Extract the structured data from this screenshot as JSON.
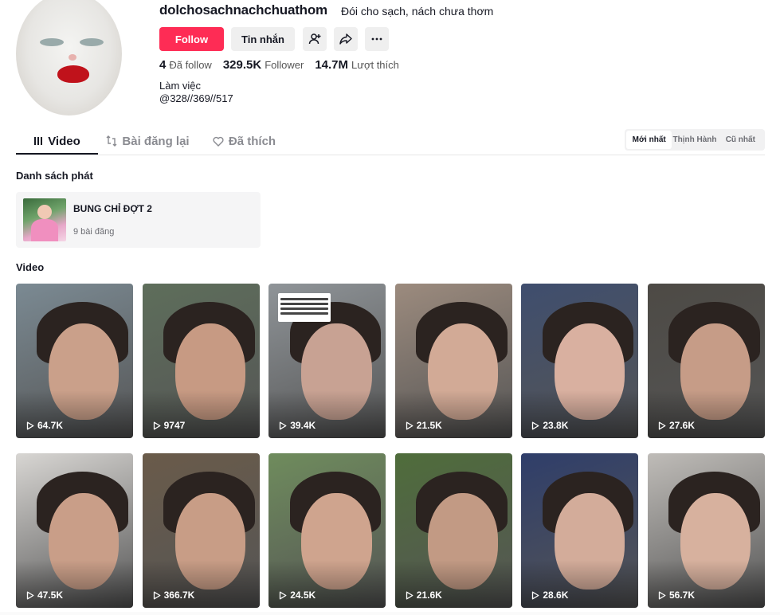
{
  "profile": {
    "username": "dolchosachnachchuathom",
    "nickname": "Đói cho sạch, nách chưa thơm",
    "follow_label": "Follow",
    "message_label": "Tin nhắn",
    "stats": [
      {
        "value": "4",
        "label": "Đã follow"
      },
      {
        "value": "329.5K",
        "label": "Follower"
      },
      {
        "value": "14.7M",
        "label": "Lượt thích"
      }
    ],
    "bio_line1": "Làm việc",
    "bio_line2": "@328//369//517"
  },
  "tabs": [
    {
      "label": "Video",
      "icon": "grid-lines-icon",
      "active": true
    },
    {
      "label": "Bài đăng lại",
      "icon": "repost-icon",
      "active": false
    },
    {
      "label": "Đã thích",
      "icon": "heart-outline-icon",
      "active": false
    }
  ],
  "sort": [
    {
      "label": "Mới nhất",
      "active": true
    },
    {
      "label": "Thịnh Hành",
      "active": false
    },
    {
      "label": "Cũ nhất",
      "active": false
    }
  ],
  "playlist_section": {
    "title": "Danh sách phát",
    "name": "BUNG CHỈ ĐỢT 2",
    "count": "9 bài đăng"
  },
  "video_section": {
    "title": "Video",
    "videos": [
      {
        "views": "64.7K",
        "bg": "#7b8a93",
        "skin": "#caa08a"
      },
      {
        "views": "9747",
        "bg": "#5e6e5b",
        "skin": "#c79a83"
      },
      {
        "views": "39.4K",
        "bg": "#8f9498",
        "skin": "#c8a293"
      },
      {
        "views": "21.5K",
        "bg": "#9c8b7e",
        "skin": "#d2aa96"
      },
      {
        "views": "23.8K",
        "bg": "#3f4e6e",
        "skin": "#d9b0a0"
      },
      {
        "views": "27.6K",
        "bg": "#4d4a45",
        "skin": "#c69c87"
      },
      {
        "views": "47.5K",
        "bg": "#d8d6d3",
        "skin": "#c99e88"
      },
      {
        "views": "366.7K",
        "bg": "#6a5b4a",
        "skin": "#c89d86"
      },
      {
        "views": "24.5K",
        "bg": "#6f8c5d",
        "skin": "#cfa48e"
      },
      {
        "views": "21.6K",
        "bg": "#4f6d3b",
        "skin": "#c29a84"
      },
      {
        "views": "28.6K",
        "bg": "#2f3e6a",
        "skin": "#d3ac9a"
      },
      {
        "views": "56.7K",
        "bg": "#bfbcb8",
        "skin": "#d7b19e"
      }
    ]
  },
  "colors": {
    "accent": "#fe2c55",
    "text": "#161823",
    "muted": "#8a8b91"
  }
}
